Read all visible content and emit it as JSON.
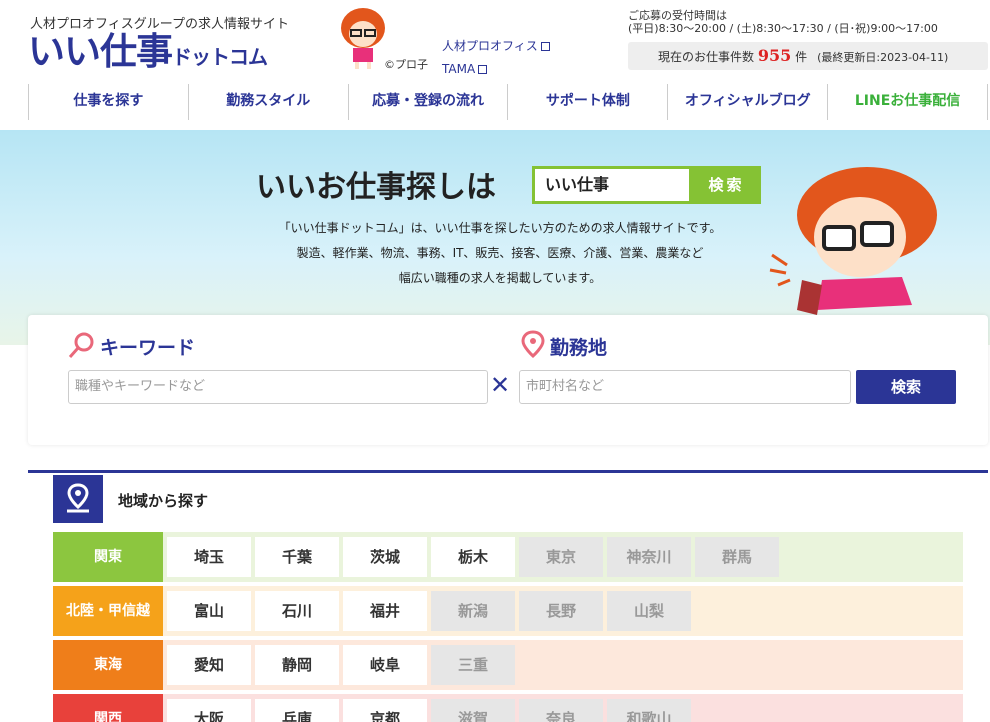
{
  "header": {
    "tagline": "人材プロオフィスグループの求人情報サイト",
    "logo_main": "いい仕事",
    "logo_sub": "ドットコム",
    "copyright": "©プロ子",
    "link1": "人材プロオフィス",
    "link2": "TAMA",
    "hours_title": "ご応募の受付時間は",
    "hours_detail": "(平日)8:30～20:00 / (土)8:30～17:30 / (日･祝)9:00～17:00",
    "count_label": "現在のお仕事件数",
    "count_value": "955",
    "count_unit": "件",
    "updated": "(最終更新日:2023-04-11)"
  },
  "nav": [
    "仕事を探す",
    "勤務スタイル",
    "応募・登録の流れ",
    "サポート体制",
    "オフィシャルブログ",
    "LINEお仕事配信"
  ],
  "hero": {
    "title": "いいお仕事探しは",
    "box_text": "いい仕事",
    "button": "検索",
    "desc1": "「いい仕事ドットコム」は、いい仕事を探したい方のための求人情報サイトです。",
    "desc2": "製造、軽作業、物流、事務、IT、販売、接客、医療、介護、営業、農業など",
    "desc3": "幅広い職種の求人を掲載しています。"
  },
  "search": {
    "keyword_label": "キーワード",
    "keyword_placeholder": "職種やキーワードなど",
    "location_label": "勤務地",
    "location_placeholder": "市町村名など",
    "button": "検索"
  },
  "region": {
    "title": "地域から探す",
    "rows": [
      {
        "label": "関東",
        "color": "#8cc63f",
        "bg": "#eaf4dc",
        "cells": [
          {
            "n": "埼玉",
            "on": true
          },
          {
            "n": "千葉",
            "on": true
          },
          {
            "n": "茨城",
            "on": true
          },
          {
            "n": "栃木",
            "on": true
          },
          {
            "n": "東京",
            "on": false
          },
          {
            "n": "神奈川",
            "on": false
          },
          {
            "n": "群馬",
            "on": false
          }
        ]
      },
      {
        "label": "北陸・甲信越",
        "color": "#f5a21a",
        "bg": "#fdf0dc",
        "cells": [
          {
            "n": "富山",
            "on": true
          },
          {
            "n": "石川",
            "on": true
          },
          {
            "n": "福井",
            "on": true
          },
          {
            "n": "新潟",
            "on": false
          },
          {
            "n": "長野",
            "on": false
          },
          {
            "n": "山梨",
            "on": false
          }
        ]
      },
      {
        "label": "東海",
        "color": "#ef7e1a",
        "bg": "#fde8dc",
        "cells": [
          {
            "n": "愛知",
            "on": true
          },
          {
            "n": "静岡",
            "on": true
          },
          {
            "n": "岐阜",
            "on": true
          },
          {
            "n": "三重",
            "on": false
          }
        ]
      },
      {
        "label": "関西",
        "color": "#e8413b",
        "bg": "#fbe0df",
        "cells": [
          {
            "n": "大阪",
            "on": true
          },
          {
            "n": "兵庫",
            "on": true
          },
          {
            "n": "京都",
            "on": true
          },
          {
            "n": "滋賀",
            "on": false
          },
          {
            "n": "奈良",
            "on": false
          },
          {
            "n": "和歌山",
            "on": false
          }
        ]
      }
    ]
  }
}
